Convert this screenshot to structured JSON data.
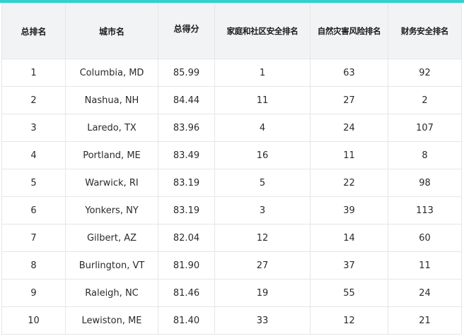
{
  "header": {
    "overall_rank": "总排名",
    "city_name": "城市名",
    "total_score": "总得分",
    "home_community_rank": "家庭和社区安全排名",
    "natural_disaster_rank": "自然灾害风险排名",
    "financial_rank": "财务安全排名"
  },
  "rows": [
    {
      "rank": "1",
      "city": "Columbia, MD",
      "score": "85.99",
      "home": "1",
      "disaster": "63",
      "financial": "92"
    },
    {
      "rank": "2",
      "city": "Nashua, NH",
      "score": "84.44",
      "home": "11",
      "disaster": "27",
      "financial": "2"
    },
    {
      "rank": "3",
      "city": "Laredo, TX",
      "score": "83.96",
      "home": "4",
      "disaster": "24",
      "financial": "107"
    },
    {
      "rank": "4",
      "city": "Portland, ME",
      "score": "83.49",
      "home": "16",
      "disaster": "11",
      "financial": "8"
    },
    {
      "rank": "5",
      "city": "Warwick, RI",
      "score": "83.19",
      "home": "5",
      "disaster": "22",
      "financial": "98"
    },
    {
      "rank": "6",
      "city": "Yonkers, NY",
      "score": "83.19",
      "home": "3",
      "disaster": "39",
      "financial": "113"
    },
    {
      "rank": "7",
      "city": "Gilbert, AZ",
      "score": "82.04",
      "home": "12",
      "disaster": "14",
      "financial": "60"
    },
    {
      "rank": "8",
      "city": "Burlington, VT",
      "score": "81.90",
      "home": "27",
      "disaster": "37",
      "financial": "11"
    },
    {
      "rank": "9",
      "city": "Raleigh, NC",
      "score": "81.46",
      "home": "19",
      "disaster": "55",
      "financial": "24"
    },
    {
      "rank": "10",
      "city": "Lewiston, ME",
      "score": "81.40",
      "home": "33",
      "disaster": "12",
      "financial": "21"
    }
  ],
  "colors": {
    "accent": "#2fd2cf",
    "header_bg": "#f2f3f5",
    "border": "#e4e6e9"
  }
}
